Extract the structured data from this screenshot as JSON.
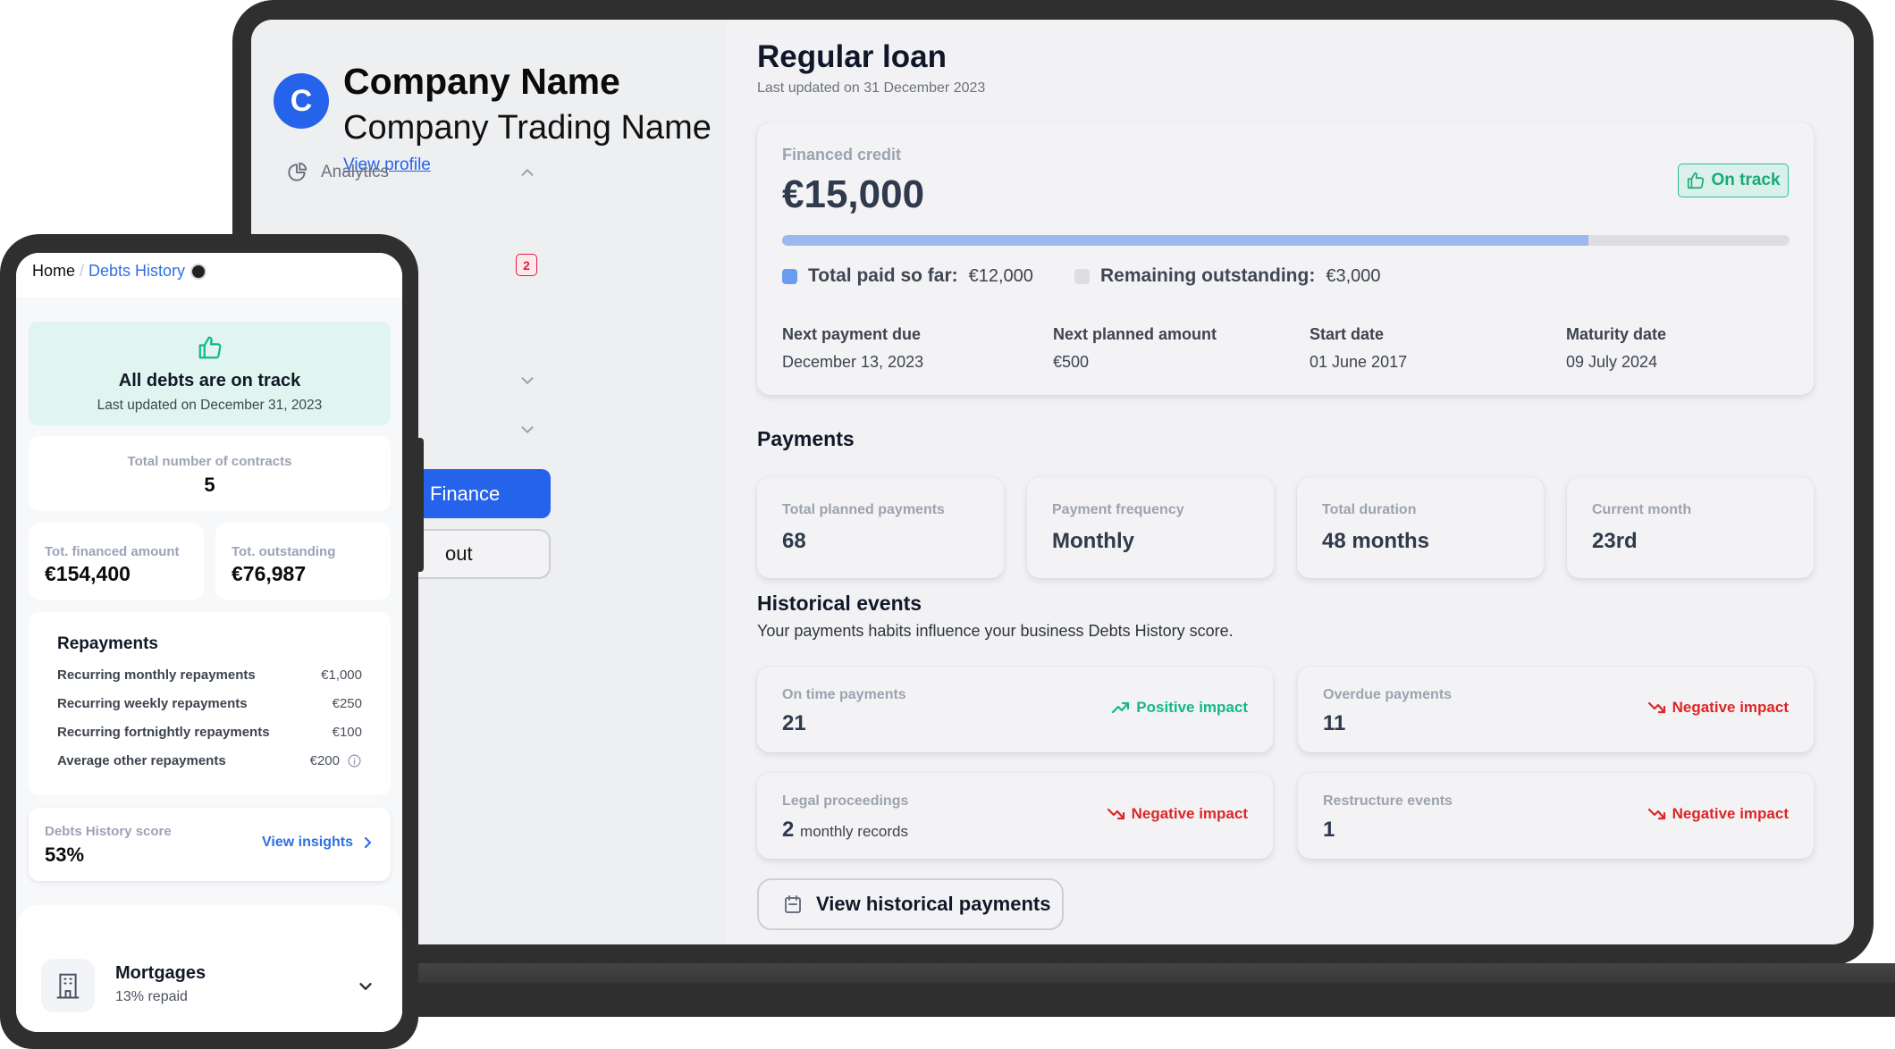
{
  "laptop": {
    "sidebar": {
      "avatar_letter": "C",
      "company_name": "Company Name",
      "trading_name": "Company Trading Name",
      "view_profile": "View profile",
      "nav": [
        {
          "label": "Analytics",
          "icon": "pie-chart-icon",
          "expanded": true
        }
      ],
      "notification_badge": "2",
      "primary_button_label": "Finance",
      "outline_button_label": "out"
    },
    "page": {
      "title": "Regular loan",
      "subtitle": "Last updated on 31 December 2023"
    },
    "loan_card": {
      "label": "Financed credit",
      "amount": "€15,000",
      "status": "On track",
      "progress_paid_fraction": 0.8,
      "paid_label": "Total paid so far:",
      "paid_value": "€12,000",
      "remaining_label": "Remaining outstanding:",
      "remaining_value": "€3,000",
      "meta": [
        {
          "label": "Next payment due",
          "value": "December 13, 2023"
        },
        {
          "label": "Next planned amount",
          "value": "€500"
        },
        {
          "label": "Start date",
          "value": "01 June 2017"
        },
        {
          "label": "Maturity date",
          "value": "09 July 2024"
        }
      ]
    },
    "payments": {
      "title": "Payments",
      "cards": [
        {
          "label": "Total planned payments",
          "value": "68"
        },
        {
          "label": "Payment frequency",
          "value": "Monthly"
        },
        {
          "label": "Total duration",
          "value": "48 months"
        },
        {
          "label": "Current month",
          "value": "23rd"
        }
      ]
    },
    "historical": {
      "title": "Historical events",
      "subtitle": "Your payments habits influence your business Debts History score.",
      "events": [
        {
          "label": "On time payments",
          "value": "21",
          "suffix": "",
          "impact": "Positive impact"
        },
        {
          "label": "Overdue payments",
          "value": "11",
          "suffix": "",
          "impact": "Negative impact"
        },
        {
          "label": "Legal proceedings",
          "value": "2",
          "suffix": "monthly records",
          "impact": "Negative impact"
        },
        {
          "label": "Restructure events",
          "value": "1",
          "suffix": "",
          "impact": "Negative impact"
        }
      ],
      "button_label": "View historical payments"
    }
  },
  "phone": {
    "breadcrumb": {
      "home": "Home",
      "separator": "/",
      "current": "Debts History"
    },
    "status": {
      "title": "All debts are on track",
      "subtitle": "Last updated on December 31, 2023"
    },
    "contracts": {
      "label": "Total number of contracts",
      "value": "5"
    },
    "totals": [
      {
        "label": "Tot. financed amount",
        "value": "€154,400"
      },
      {
        "label": "Tot. outstanding",
        "value": "€76,987"
      }
    ],
    "repayments": {
      "title": "Repayments",
      "rows": [
        {
          "label": "Recurring monthly repayments",
          "value": "€1,000"
        },
        {
          "label": "Recurring weekly repayments",
          "value": "€250"
        },
        {
          "label": "Recurring fortnightly repayments",
          "value": "€100"
        },
        {
          "label": "Average other repayments",
          "value": "€200"
        }
      ]
    },
    "score": {
      "label": "Debts History score",
      "value": "53%",
      "link": "View insights"
    },
    "mortgage": {
      "title": "Mortgages",
      "subtitle": "13% repaid"
    }
  },
  "colors": {
    "accent": "#2563eb",
    "positive": "#14b885",
    "negative": "#dc2626",
    "progress_fill": "#9db8f0",
    "progress_track": "#dcdee2",
    "device_frame": "#2f2f2f"
  }
}
